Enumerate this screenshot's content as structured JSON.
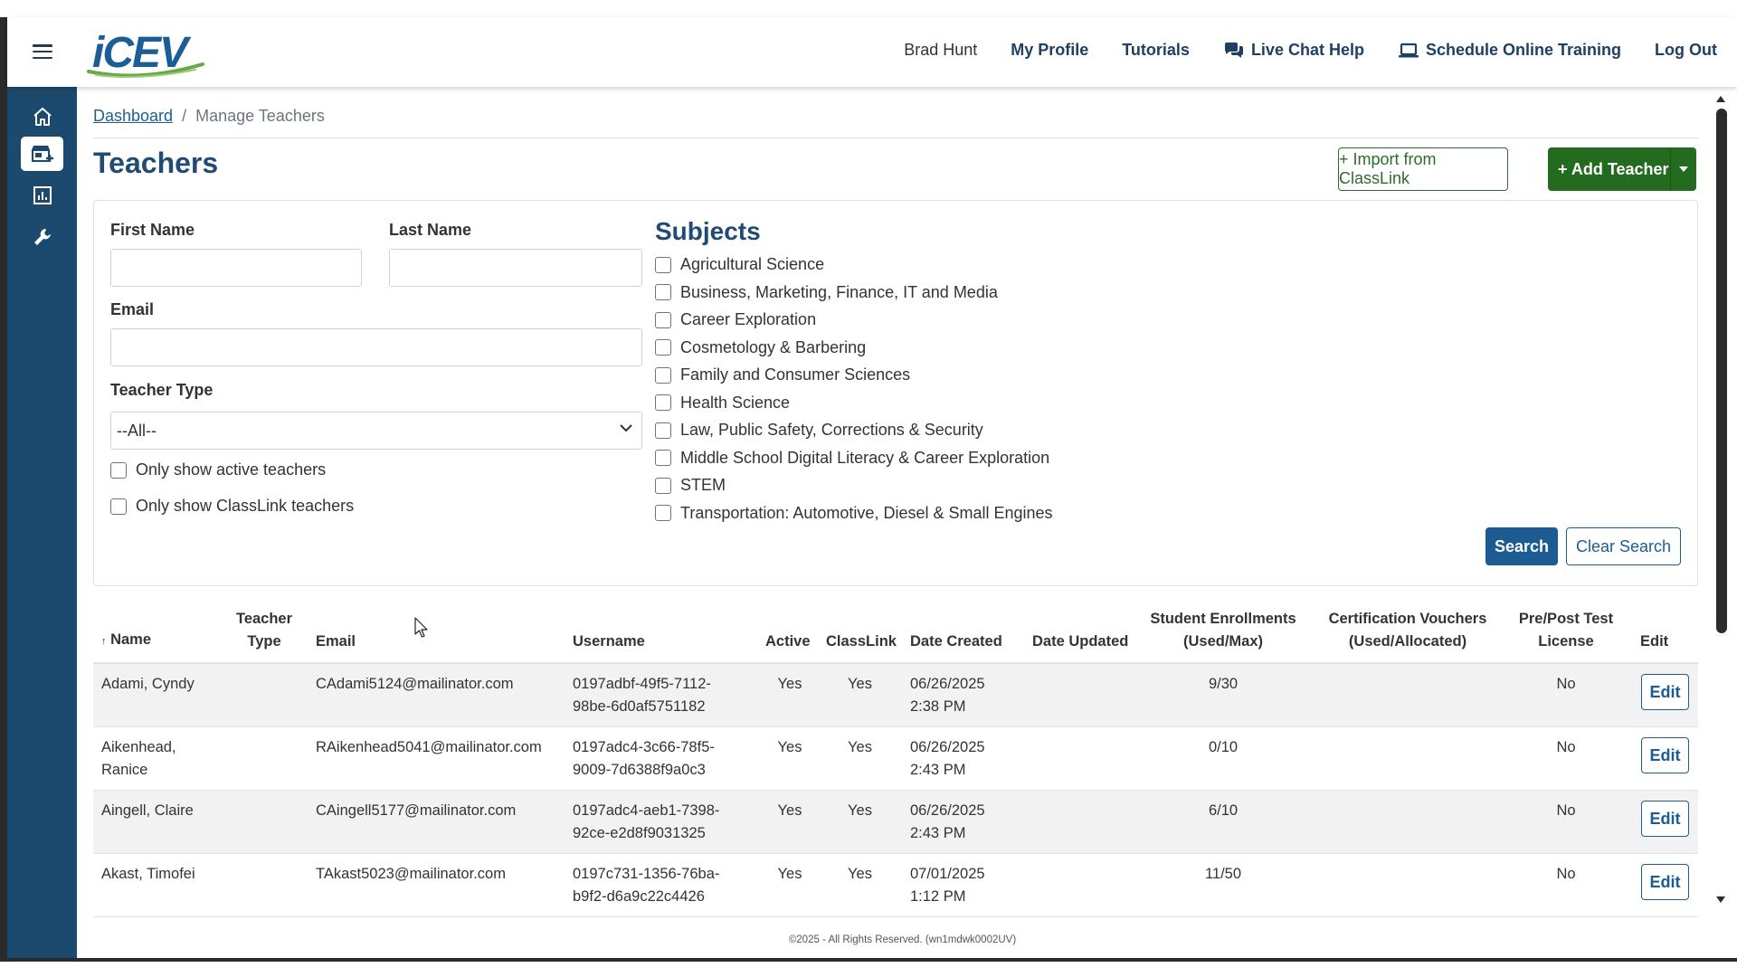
{
  "header": {
    "logo_text": "iCEV",
    "user_name": "Brad Hunt",
    "nav": {
      "my_profile": "My Profile",
      "tutorials": "Tutorials",
      "live_chat": "Live Chat Help",
      "schedule_training": "Schedule Online Training",
      "logout": "Log Out"
    }
  },
  "sidebar": {
    "items": [
      {
        "icon": "home-icon"
      },
      {
        "icon": "store-add-icon",
        "active": true
      },
      {
        "icon": "report-chart-icon"
      },
      {
        "icon": "wrench-icon"
      }
    ]
  },
  "breadcrumb": {
    "dashboard": "Dashboard",
    "separator": "/",
    "current": "Manage Teachers"
  },
  "page": {
    "title": "Teachers",
    "import_button": "+ Import from ClassLink",
    "add_button": "+ Add Teacher"
  },
  "filters": {
    "first_name_label": "First Name",
    "first_name_value": "",
    "last_name_label": "Last Name",
    "last_name_value": "",
    "email_label": "Email",
    "email_value": "",
    "teacher_type_label": "Teacher Type",
    "teacher_type_value": "--All--",
    "only_active_label": "Only show active teachers",
    "only_classlink_label": "Only show ClassLink teachers",
    "subjects_title": "Subjects",
    "subjects": [
      "Agricultural Science",
      "Business, Marketing, Finance, IT and Media",
      "Career Exploration",
      "Cosmetology & Barbering",
      "Family and Consumer Sciences",
      "Health Science",
      "Law, Public Safety, Corrections & Security",
      "Middle School Digital Literacy & Career Exploration",
      "STEM",
      "Transportation: Automotive, Diesel & Small Engines"
    ],
    "search_button": "Search",
    "clear_button": "Clear Search"
  },
  "table": {
    "headers": {
      "sort_indicator": "↑",
      "name": "Name",
      "teacher_type_1": "Teacher",
      "teacher_type_2": "Type",
      "email": "Email",
      "username": "Username",
      "active": "Active",
      "classlink": "ClassLink",
      "date_created": "Date Created",
      "date_updated": "Date Updated",
      "enroll_1": "Student Enrollments",
      "enroll_2": "(Used/Max)",
      "vouchers_1": "Certification Vouchers",
      "vouchers_2": "(Used/Allocated)",
      "prepost_1": "Pre/Post Test",
      "prepost_2": "License",
      "edit": "Edit"
    },
    "rows": [
      {
        "name_1": "Adami, Cyndy",
        "name_2": "",
        "type": "",
        "email": "CAdami5124@mailinator.com",
        "user_1": "0197adbf-49f5-7112-",
        "user_2": "98be-6d0af5751182",
        "active": "Yes",
        "classlink": "Yes",
        "created_1": "06/26/2025",
        "created_2": "2:38 PM",
        "updated": "",
        "enroll": "9/30",
        "vouchers": "",
        "prepost": "No",
        "edit": "Edit"
      },
      {
        "name_1": "Aikenhead,",
        "name_2": "Ranice",
        "type": "",
        "email": "RAikenhead5041@mailinator.com",
        "user_1": "0197adc4-3c66-78f5-",
        "user_2": "9009-7d6388f9a0c3",
        "active": "Yes",
        "classlink": "Yes",
        "created_1": "06/26/2025",
        "created_2": "2:43 PM",
        "updated": "",
        "enroll": "0/10",
        "vouchers": "",
        "prepost": "No",
        "edit": "Edit"
      },
      {
        "name_1": "Aingell, Claire",
        "name_2": "",
        "type": "",
        "email": "CAingell5177@mailinator.com",
        "user_1": "0197adc4-aeb1-7398-",
        "user_2": "92ce-e2d8f9031325",
        "active": "Yes",
        "classlink": "Yes",
        "created_1": "06/26/2025",
        "created_2": "2:43 PM",
        "updated": "",
        "enroll": "6/10",
        "vouchers": "",
        "prepost": "No",
        "edit": "Edit"
      },
      {
        "name_1": "Akast, Timofei",
        "name_2": "",
        "type": "",
        "email": "TAkast5023@mailinator.com",
        "user_1": "0197c731-1356-76ba-",
        "user_2": "b9f2-d6a9c22c4426",
        "active": "Yes",
        "classlink": "Yes",
        "created_1": "07/01/2025",
        "created_2": "1:12 PM",
        "updated": "",
        "enroll": "11/50",
        "vouchers": "",
        "prepost": "No",
        "edit": "Edit"
      }
    ]
  },
  "footer": {
    "text": "©2025 - All Rights Reserved. (wn1mdwk0002UV)"
  },
  "colors": {
    "primary": "#1c5c93",
    "sidebar": "#1c4a6e",
    "success": "#226b1f",
    "title": "#1f4b75"
  }
}
